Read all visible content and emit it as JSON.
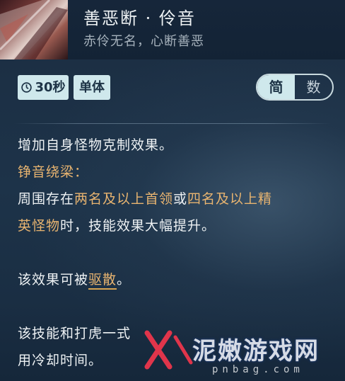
{
  "skill": {
    "title": "善恶断 · 伶音",
    "subtitle": "赤伶无名，心断善恶"
  },
  "tags": {
    "cooldown": "30秒",
    "target": "单体"
  },
  "toggle": {
    "simple": "简",
    "numeric": "数",
    "selected": "简"
  },
  "description": {
    "line1": "增加自身怪物克制效果。",
    "section_title": "铮音绕梁：",
    "line3_a": "周围存在",
    "line3_b": "两名及以上首领",
    "line3_c": "或",
    "line3_d": "四名及以上精",
    "line4_a": "英怪物",
    "line4_b": "时，技能效果大幅提升。",
    "line5_a": "该效果可被",
    "line5_b": "驱散",
    "line5_c": "。",
    "line6": "该技能和打虎一式",
    "line7": "用冷却时间。"
  },
  "watermark": {
    "text": "泥嫩游戏网",
    "url": "pnbag.com"
  },
  "colors": {
    "highlight": "#e8b470",
    "tag_bg": "#cfe8ec",
    "body_text": "#eef2f4"
  }
}
